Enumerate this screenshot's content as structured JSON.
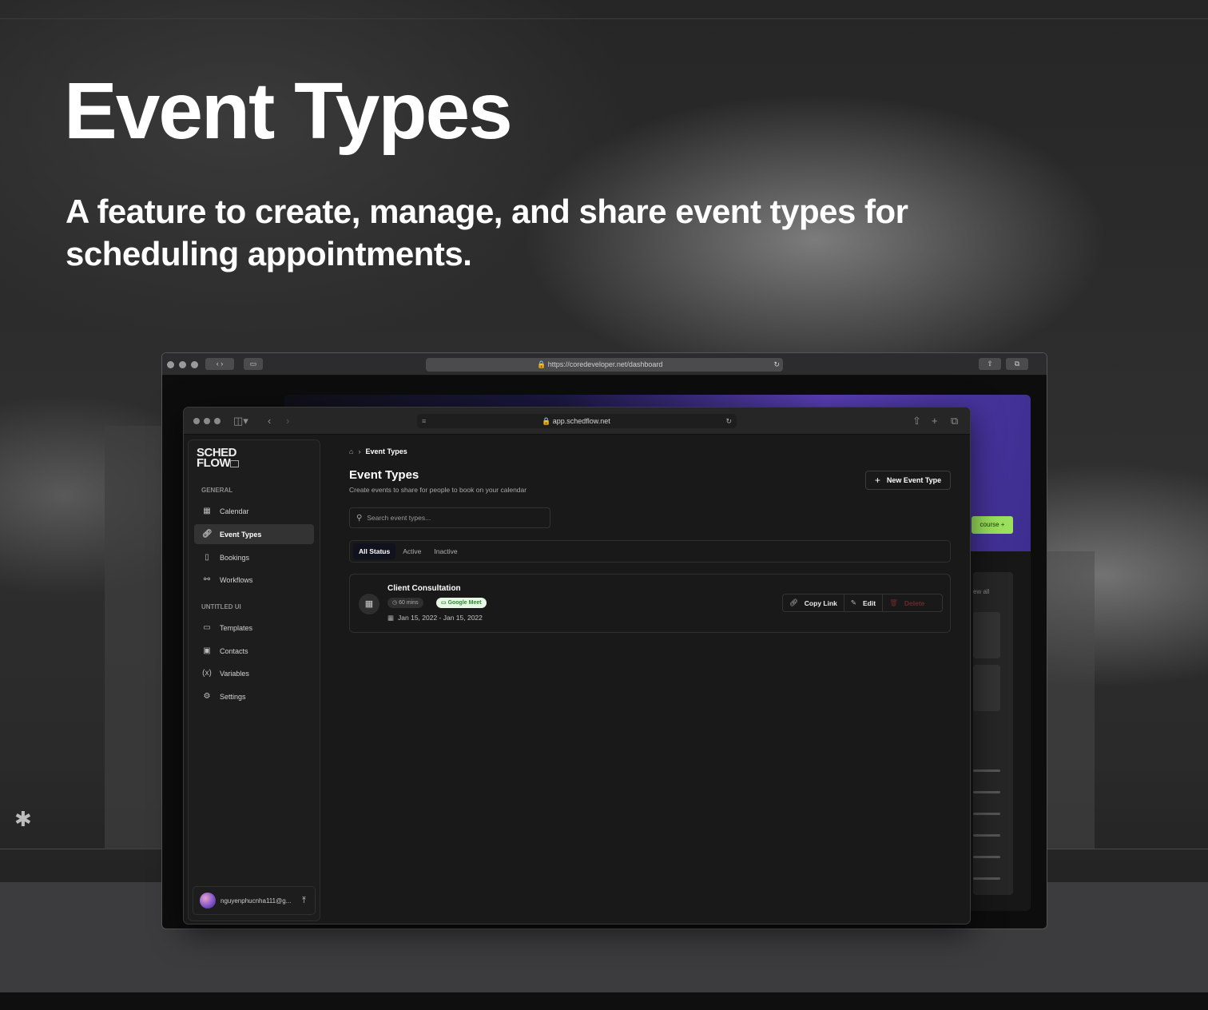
{
  "hero": {
    "title": "Event Types",
    "subtitle": "A feature to create, manage, and share event types for scheduling appointments."
  },
  "back_browser": {
    "url": "https://coredeveloper.net/dashboard",
    "course_button": "course +",
    "view_all": "ew all"
  },
  "browser": {
    "url": "app.schedflow.net"
  },
  "sidebar": {
    "logo_line1": "SCHED",
    "logo_line2": "FLOW",
    "general_label": "GENERAL",
    "general_items": [
      {
        "label": "Calendar",
        "icon": "calendar-icon"
      },
      {
        "label": "Event Types",
        "icon": "link-icon"
      },
      {
        "label": "Bookings",
        "icon": "book-icon"
      },
      {
        "label": "Workflows",
        "icon": "workflow-icon"
      }
    ],
    "untitled_label": "UNTITLED UI",
    "untitled_items": [
      {
        "label": "Templates",
        "icon": "folder-icon"
      },
      {
        "label": "Contacts",
        "icon": "contacts-icon"
      },
      {
        "label": "Variables",
        "icon": "variable-icon"
      },
      {
        "label": "Settings",
        "icon": "gear-icon"
      }
    ],
    "user_email": "nguyenphucnha111@g..."
  },
  "main": {
    "breadcrumb_current": "Event Types",
    "title": "Event Types",
    "description": "Create events to share for people to book on your calendar",
    "new_button": "New Event Type",
    "search_placeholder": "Search event types...",
    "tabs": [
      "All Status",
      "Active",
      "Inactive"
    ],
    "active_tab": "All Status",
    "events": [
      {
        "name": "Client Consultation",
        "duration": "60 mins",
        "location": "Google Meet",
        "dates": "Jan 15, 2022 - Jan 15, 2022",
        "actions": [
          "Copy Link",
          "Edit",
          "Delete"
        ]
      }
    ]
  },
  "colors": {
    "accent_active_tab": "#10131d",
    "meet_badge_bg": "#e7f7e6",
    "meet_badge_text": "#2f8a2f",
    "delete_text": "#6a2a2a",
    "course_button": "#9be15d"
  }
}
